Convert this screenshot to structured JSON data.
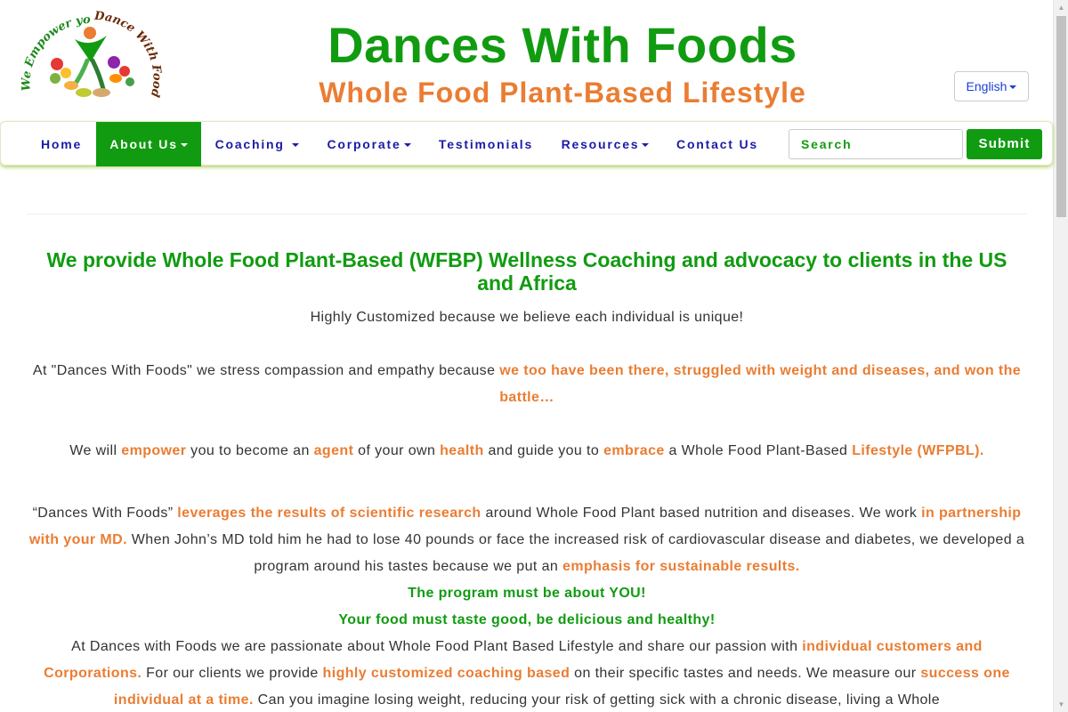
{
  "header": {
    "title": "Dances With Foods",
    "subtitle": "Whole Food Plant-Based Lifestyle",
    "logo_text": "We Empower you ! Dance With Foods",
    "language_label": "English"
  },
  "nav": {
    "items": [
      {
        "label": "Home",
        "dropdown": false,
        "active": false
      },
      {
        "label": "About Us",
        "dropdown": true,
        "active": true
      },
      {
        "label": "Coaching ",
        "dropdown": true,
        "active": false
      },
      {
        "label": "Corporate",
        "dropdown": true,
        "active": false
      },
      {
        "label": "Testimonials",
        "dropdown": false,
        "active": false
      },
      {
        "label": "Resources",
        "dropdown": true,
        "active": false
      },
      {
        "label": "Contact Us",
        "dropdown": false,
        "active": false
      }
    ],
    "search_placeholder": "Search",
    "submit_label": "Submit"
  },
  "content": {
    "headline": "We provide Whole Food Plant-Based (WFBP) Wellness Coaching and advocacy to clients in the US and Africa",
    "tagline": "Highly Customized because we believe each individual is unique!",
    "p1": {
      "a": "At \"Dances With Foods\" we stress compassion and empathy because ",
      "b": "we too have been there, struggled with weight and diseases, and won the battle…"
    },
    "p2": {
      "a": "We will ",
      "b": "empower",
      "c": " you to become an ",
      "d": "agent",
      "e": " of your own ",
      "f": "health",
      "g": " and guide you to ",
      "h": "embrace",
      "i": " a Whole Food Plant-Based ",
      "j": "Lifestyle (WFPBL)."
    },
    "p3": {
      "a": "“Dances With Foods” ",
      "b": "leverages the results of scientific research",
      "c": " around Whole Food Plant based nutrition and diseases. We work ",
      "d": "in partnership with your MD.",
      "e": " When John’s MD told him he had to lose 40 pounds or face the increased risk of cardiovascular disease and diabetes, we developed a program around his tastes because we put an ",
      "f": "emphasis for sustainable results."
    },
    "emph1": "The program must be about YOU!",
    "emph2": "Your food must taste good, be delicious and healthy!",
    "p4": {
      "a": "At Dances with Foods we are passionate about Whole Food Plant Based Lifestyle and share our passion with ",
      "b": "individual customers and Corporations.",
      "c": " For our clients we provide ",
      "d": "highly customized coaching based",
      "e": " on their specific tastes and needs. We measure our ",
      "f": "success one individual at a time.",
      "g": " Can you imagine losing weight, reducing your risk of getting sick with a chronic disease, living a Whole"
    }
  },
  "colors": {
    "brand_green": "#119b11",
    "accent_orange": "#ea7d33",
    "nav_blue": "#1b1ba6"
  }
}
